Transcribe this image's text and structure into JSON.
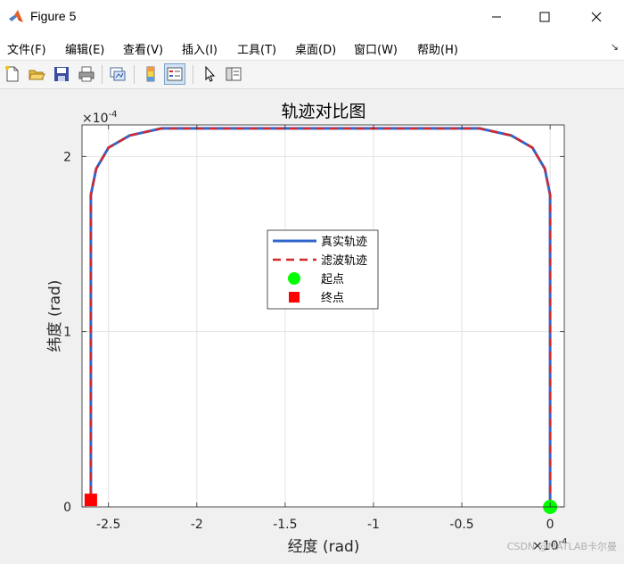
{
  "window": {
    "title": "Figure 5",
    "colors": {
      "titlebar": "#ffffff",
      "frame": "#f0f0f0"
    }
  },
  "menu": {
    "items": [
      "文件(F)",
      "编辑(E)",
      "查看(V)",
      "插入(I)",
      "工具(T)",
      "桌面(D)",
      "窗口(W)",
      "帮助(H)"
    ],
    "corner_icon": "dock-arrow-icon"
  },
  "toolbar": {
    "buttons": [
      {
        "icon": "new-figure-icon"
      },
      {
        "icon": "open-file-icon"
      },
      {
        "icon": "save-icon"
      },
      {
        "icon": "print-icon"
      },
      {
        "icon": "link-plot-icon"
      },
      {
        "icon": "colorbar-icon"
      },
      {
        "icon": "legend-icon",
        "active": true
      },
      {
        "icon": "pointer-icon"
      },
      {
        "icon": "property-inspector-icon"
      }
    ]
  },
  "chart_data": {
    "type": "line",
    "title": "轨迹对比图",
    "xlabel": "经度 (rad)",
    "ylabel": "纬度 (rad)",
    "x_exponent_label": "×10^-4",
    "y_exponent_label": "×10^-4",
    "xlim": [
      -2.65,
      0.08
    ],
    "ylim": [
      0,
      2.18
    ],
    "x_ticks": [
      -2.5,
      -2,
      -1.5,
      -1,
      -0.5,
      0
    ],
    "x_tick_labels": [
      "-2.5",
      "-2",
      "-1.5",
      "-1",
      "-0.5",
      "0"
    ],
    "y_ticks": [
      0,
      1,
      2
    ],
    "y_tick_labels": [
      "0",
      "1",
      "2"
    ],
    "grid": true,
    "legend_placement": "center",
    "series": [
      {
        "name": "真实轨迹",
        "style": "solid",
        "color": "#3366cc",
        "x": [
          0,
          0,
          -0.03,
          -0.1,
          -0.22,
          -0.4,
          -2.2,
          -2.38,
          -2.5,
          -2.57,
          -2.6,
          -2.6
        ],
        "y": [
          0,
          1.78,
          1.93,
          2.05,
          2.12,
          2.16,
          2.16,
          2.12,
          2.05,
          1.93,
          1.78,
          0.04
        ]
      },
      {
        "name": "滤波轨迹",
        "style": "dashed",
        "color": "#d62728",
        "x": [
          0,
          0,
          -0.03,
          -0.1,
          -0.22,
          -0.4,
          -2.2,
          -2.38,
          -2.5,
          -2.57,
          -2.6,
          -2.6
        ],
        "y": [
          0,
          1.78,
          1.93,
          2.05,
          2.12,
          2.16,
          2.16,
          2.12,
          2.05,
          1.93,
          1.78,
          0.04
        ]
      },
      {
        "name": "起点",
        "style": "marker-circle",
        "color": "#00ff00",
        "x": [
          0
        ],
        "y": [
          0
        ]
      },
      {
        "name": "终点",
        "style": "marker-square",
        "color": "#ff0000",
        "x": [
          -2.6
        ],
        "y": [
          0.04
        ]
      }
    ]
  },
  "watermark": "CSDN @MATLAB卡尔曼"
}
